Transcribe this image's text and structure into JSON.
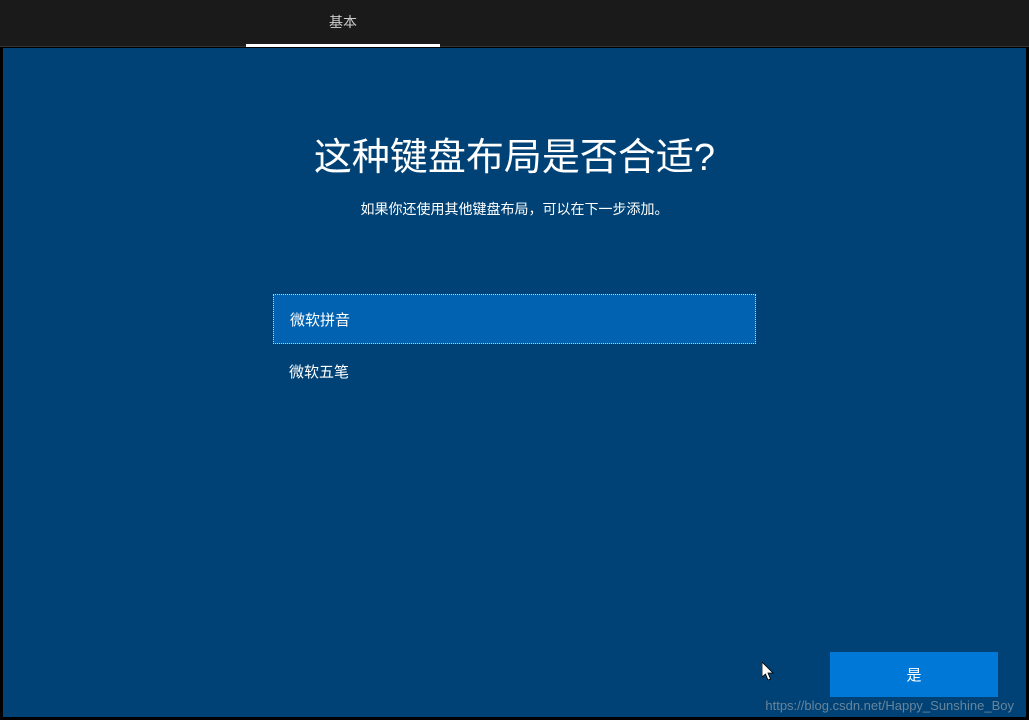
{
  "tab": {
    "label": "基本"
  },
  "heading": "这种键盘布局是否合适?",
  "subtitle": "如果你还使用其他键盘布局，可以在下一步添加。",
  "options": [
    {
      "label": "微软拼音",
      "selected": true
    },
    {
      "label": "微软五笔",
      "selected": false
    }
  ],
  "buttons": {
    "confirm": "是"
  },
  "watermark": "https://blog.csdn.net/Happy_Sunshine_Boy"
}
